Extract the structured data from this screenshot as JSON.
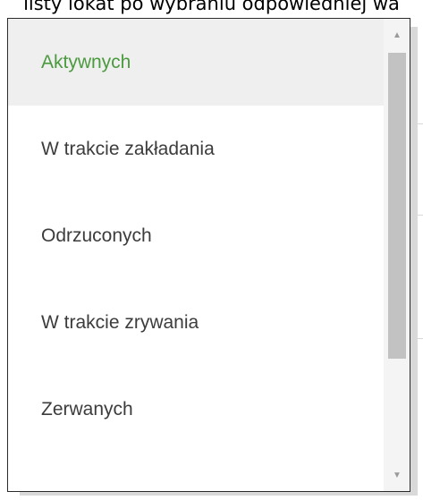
{
  "background": {
    "caption": "listy lokat po wybraniu odpowiedniej wa"
  },
  "dropdown": {
    "options": [
      {
        "label": "Aktywnych",
        "selected": true
      },
      {
        "label": "W trakcie zakładania",
        "selected": false
      },
      {
        "label": "Odrzuconych",
        "selected": false
      },
      {
        "label": "W trakcie zrywania",
        "selected": false
      },
      {
        "label": "Zerwanych",
        "selected": false
      }
    ],
    "accent_color": "#4c9a3f",
    "scroll": {
      "up_icon": "triangle-up",
      "down_icon": "triangle-down"
    }
  }
}
